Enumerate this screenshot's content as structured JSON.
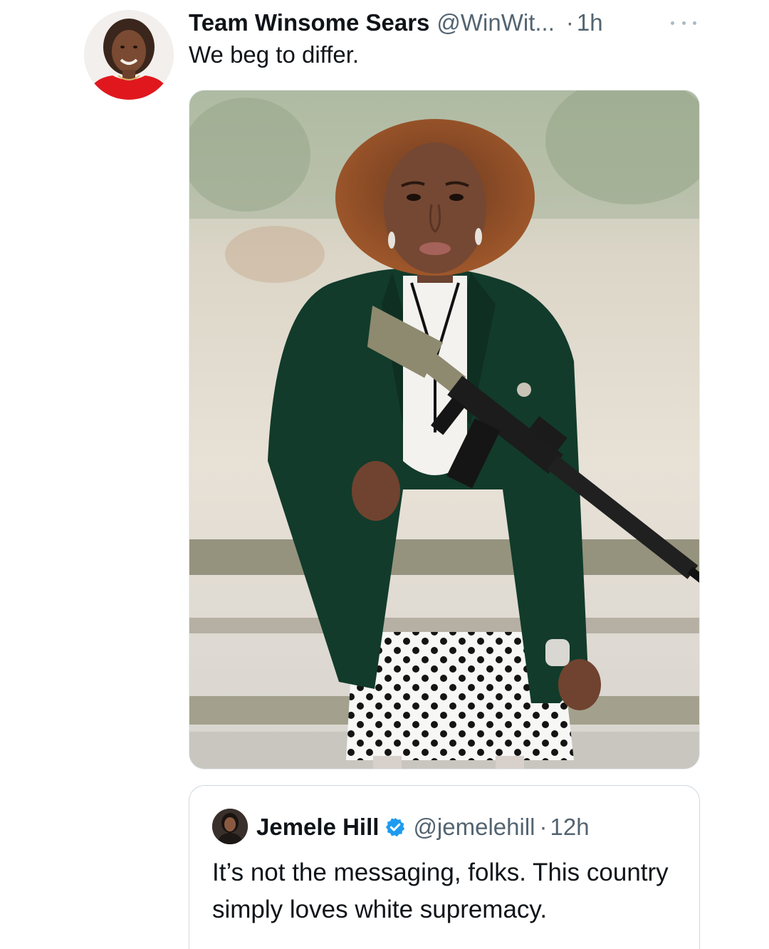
{
  "tweet": {
    "display_name": "Team Winsome Sears",
    "handle": "@WinWit...",
    "separator": "·",
    "time": "1h",
    "text": "We beg to differ.",
    "more_icon": "more-horizontal-icon",
    "avatar": "profile-photo",
    "media": "photo-woman-green-blazer-holding-rifle"
  },
  "quoted_tweet": {
    "display_name": "Jemele Hill",
    "verified_icon": "verified-badge-icon",
    "handle": "@jemelehill",
    "separator": "·",
    "time": "12h",
    "text": "It’s not the messaging, folks. This country simply loves white supremacy.",
    "avatar": "profile-photo"
  },
  "colors": {
    "text_primary": "#0f1419",
    "text_secondary": "#536471",
    "verified_blue": "#1d9bf0",
    "border": "#cfd9de"
  }
}
